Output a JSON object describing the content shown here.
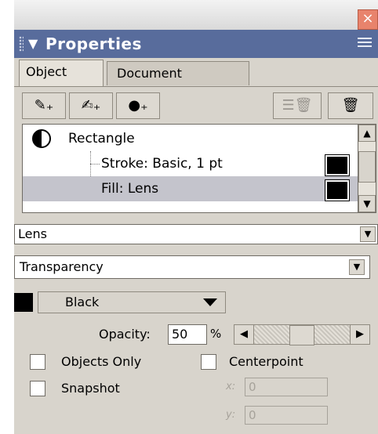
{
  "window": {
    "close_glyph": "×"
  },
  "panel": {
    "title": "Properties",
    "collapse_glyph": "▼"
  },
  "tabs": [
    {
      "label": "Object"
    },
    {
      "label": "Document"
    }
  ],
  "toolbar": {
    "buttons": [
      {
        "name": "add-stroke-button",
        "icon": "pencil-icon",
        "glyph": "✎₊"
      },
      {
        "name": "add-effect-button",
        "icon": "pen-tool-icon",
        "glyph": "✍₊"
      },
      {
        "name": "add-fill-button",
        "icon": "circle-icon",
        "glyph": "●₊"
      },
      {
        "name": "delete-attribute-button",
        "icon": "list-trash-icon",
        "glyph": "☰🗑"
      },
      {
        "name": "trash-button",
        "icon": "trash-icon",
        "glyph": "🗑"
      }
    ]
  },
  "attributes_list": {
    "items": [
      {
        "label": "Rectangle",
        "icon": "rectangle-object-icon"
      },
      {
        "label": "Stroke: Basic, 1 pt",
        "swatch": "#000000"
      },
      {
        "label": "Fill: Lens",
        "swatch": "#000000",
        "selected": true
      }
    ]
  },
  "fill_type": {
    "value": "Lens"
  },
  "lens_mode": {
    "value": "Transparency"
  },
  "lens_color": {
    "swatch": "#000000",
    "value": "Black"
  },
  "opacity": {
    "label": "Opacity:",
    "value": "50",
    "unit": "%",
    "level": 0.5
  },
  "options": {
    "objects_only": {
      "label": "Objects Only",
      "checked": false
    },
    "centerpoint": {
      "label": "Centerpoint",
      "checked": false
    },
    "snapshot": {
      "label": "Snapshot",
      "checked": false
    }
  },
  "center": {
    "x_label": "x:",
    "x_value": "0",
    "y_label": "y:",
    "y_value": "0"
  },
  "colors": {
    "titlebar": "#586c9c",
    "panel_bg": "#d8d4cc",
    "selected_row": "#c4c4cc"
  }
}
